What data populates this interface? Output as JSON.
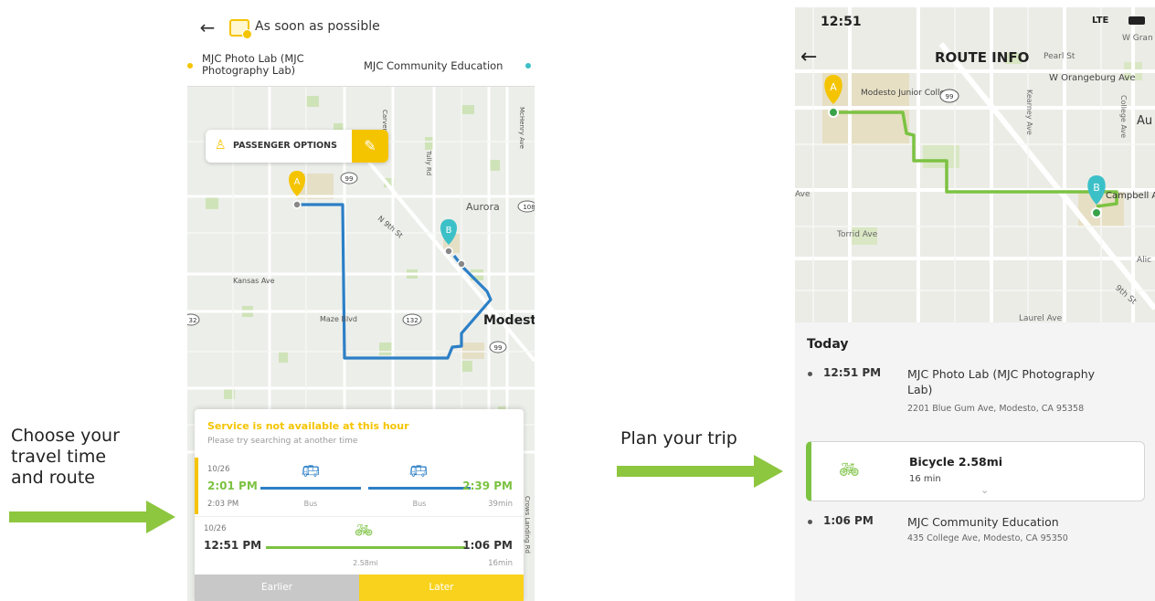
{
  "left_caption": [
    "Choose your",
    "travel time",
    "and route"
  ],
  "middle_caption": "Plan your trip",
  "phone1": {
    "header": {
      "time_option": "As soon as possible",
      "origin": "MJC Photo Lab (MJC Photography Lab)",
      "destination": "MJC Community Education"
    },
    "passenger_options_label": "PASSENGER OPTIONS",
    "map_labels": {
      "kansas_ave": "Kansas Ave",
      "maze_blvd": "Maze Blvd",
      "aurora": "Aurora",
      "n9th": "N 9th St",
      "modesto": "Modest",
      "tully": "Tully Rd",
      "carver": "Carver Rd",
      "mchenry": "McHenry Ave",
      "crows": "Crows Landing Rd",
      "hw99a": "99",
      "hw99b": "99",
      "hw132": "132",
      "hw32": "32",
      "hw108": "108",
      "pin_a": "A",
      "pin_b": "B"
    },
    "service_notice": {
      "title": "Service is not available at this hour",
      "subtitle": "Please try searching at another time"
    },
    "trips": [
      {
        "date": "10/26",
        "depart": "2:01 PM",
        "depart_sub": "2:03 PM",
        "mode1": "Bus",
        "mode2": "Bus",
        "arrive": "2:39 PM",
        "duration": "39min"
      },
      {
        "date": "10/26",
        "depart": "12:51 PM",
        "distance": "2.58mi",
        "arrive": "1:06 PM",
        "duration": "16min"
      }
    ],
    "buttons": {
      "earlier": "Earlier",
      "later": "Later"
    }
  },
  "phone2": {
    "status": {
      "time": "12:51",
      "network": "LTE"
    },
    "title": "ROUTE INFO",
    "map_labels": {
      "pearl": "Pearl St",
      "w_orangeburg": "W Orangeburg Ave",
      "w_gran": "W Gran",
      "college_top": "Modesto Junior College",
      "kearney": "Kearney Ave",
      "college_ave": "College Ave",
      "au": "Au",
      "torrid": "Torrid Ave",
      "campbell": "Campbell Ave",
      "alic": "Alic",
      "ninth": "9th St",
      "laurel": "Laurel Ave",
      "ave_left": "Ave",
      "hw99": "99",
      "pin_a": "A",
      "pin_b": "B"
    },
    "day_label": "Today",
    "stops": [
      {
        "time": "12:51 PM",
        "name": "MJC Photo Lab (MJC Photography Lab)",
        "address": "2201 Blue Gum Ave, Modesto, CA 95358"
      },
      {
        "time": "1:06 PM",
        "name": "MJC Community Education",
        "address": "435 College Ave, Modesto, CA 95350"
      }
    ],
    "leg": {
      "title": "Bicycle 2.58mi",
      "duration": "16 min"
    }
  },
  "colors": {
    "accent_yellow": "#f5c400",
    "bus_blue": "#2c7fc6",
    "bike_green": "#7cc242",
    "teal": "#3cc0c8",
    "arrow_green": "#8dc63f"
  }
}
